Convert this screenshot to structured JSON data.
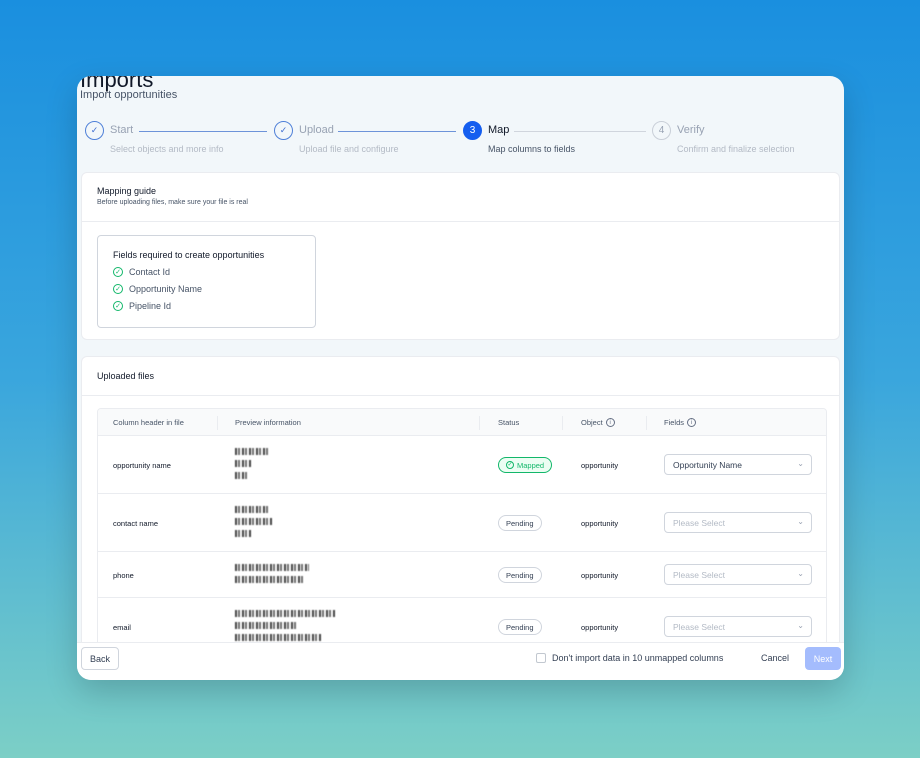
{
  "header": {
    "title": "Imports",
    "subtitle": "Import opportunities"
  },
  "stepper": {
    "steps": [
      {
        "number": "1",
        "title": "Start",
        "description": "Select objects and more info",
        "state": "done"
      },
      {
        "number": "2",
        "title": "Upload",
        "description": "Upload file and configure",
        "state": "done"
      },
      {
        "number": "3",
        "title": "Map",
        "description": "Map columns to fields",
        "state": "active"
      },
      {
        "number": "4",
        "title": "Verify",
        "description": "Confirm and finalize selection",
        "state": "todo"
      }
    ],
    "check_glyph": "✓"
  },
  "mapping_guide": {
    "title": "Mapping guide",
    "subtitle": "Before uploading files, make sure your file is real",
    "required_title": "Fields required to create opportunities",
    "required_fields": [
      "Contact Id",
      "Opportunity Name",
      "Pipeline Id"
    ]
  },
  "uploaded_files": {
    "title": "Uploaded files",
    "columns": {
      "header_in_file": "Column header in file",
      "preview": "Preview information",
      "status": "Status",
      "object": "Object",
      "fields": "Fields"
    },
    "rows": [
      {
        "column": "opportunity name",
        "status": "Mapped",
        "object": "opportunity",
        "field": "Opportunity Name",
        "mapped": true
      },
      {
        "column": "contact name",
        "status": "Pending",
        "object": "opportunity",
        "field": "Please Select",
        "mapped": false
      },
      {
        "column": "phone",
        "status": "Pending",
        "object": "opportunity",
        "field": "Please Select",
        "mapped": false
      },
      {
        "column": "email",
        "status": "Pending",
        "object": "opportunity",
        "field": "Please Select",
        "mapped": false
      }
    ]
  },
  "footer": {
    "back_label": "Back",
    "skip_label": "Don't import data in 10 unmapped columns",
    "cancel_label": "Cancel",
    "next_label": "Next"
  },
  "colors": {
    "accent": "#155eef",
    "success": "#12b76a",
    "next_disabled": "#a4bcfd"
  },
  "icons": {
    "info": "i",
    "chevron": "⌄",
    "check": "✓"
  }
}
